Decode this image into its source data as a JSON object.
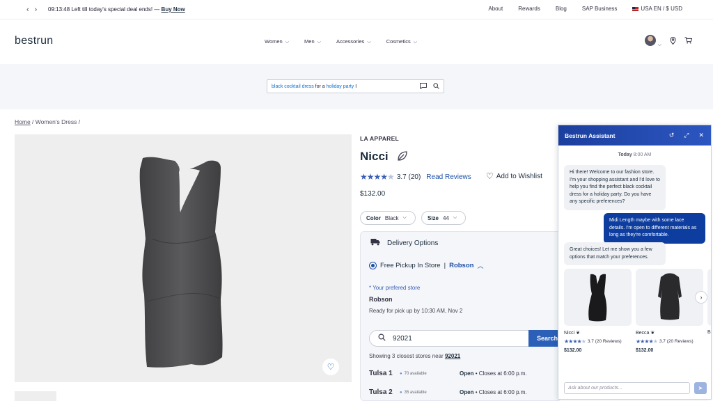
{
  "promo": {
    "timer": "09:13:48",
    "message": "Left till today's special deal ends! —",
    "cta": "Buy Now",
    "links": [
      "About",
      "Rewards",
      "Blog",
      "SAP Business"
    ],
    "locale": "USA EN / $ USD"
  },
  "header": {
    "logo": "bestrun",
    "nav": [
      "Women",
      "Men",
      "Accessories",
      "Cosmetics"
    ]
  },
  "search": {
    "q1": "black",
    "q2": " cocktail dress ",
    "q3": "for a ",
    "q4": "holiday party",
    "q5": " I"
  },
  "breadcrumb": {
    "home": "Home",
    "category": "Women's Dress"
  },
  "product": {
    "brand": "LA APPAREL",
    "name": "Nicci",
    "rating": 3.7,
    "rating_text": "3.7 (20)",
    "reviews_link": "Read Reviews",
    "wishlist": "Add to Wishlist",
    "price": "$132.00",
    "color_label": "Color",
    "color_value": "Black",
    "size_label": "Size",
    "size_value": "44"
  },
  "delivery": {
    "title": "Delivery Options",
    "option": "Free Pickup In Store",
    "selected_store": "Robson",
    "pref_label": "* Your prefered store",
    "pref_store": "Robson",
    "ready": "Ready for pick up by 10:30 AM, Nov 2",
    "zip": "92021",
    "search_btn": "Search",
    "showing_prefix": "Showing 3 closest stores near",
    "showing_zip": "92021",
    "stores": [
      {
        "name": "Tulsa 1",
        "available": "70 available",
        "status": "Open",
        "closes": "• Closes at 6:00 p.m."
      },
      {
        "name": "Tulsa 2",
        "available": "35 available",
        "status": "Open",
        "closes": "• Closes at 6:00 p.m."
      }
    ]
  },
  "assistant": {
    "title": "Bestrun Assistant",
    "today": "Today",
    "time": "8:00 AM",
    "msg1": "Hi there! Welcome to our fashion store. I'm your shopping assistant and I'd love to help you find the perfect black cocktail dress for a holiday party. Do you have any specific preferences?",
    "msg2": "Midi Length maybe with some lace details. I'm open to different materials as long as they're comfortable.",
    "msg3": "Great choices! Let me show you a few options that match your preferences.",
    "cards": [
      {
        "name": "Nicci",
        "rating": 3.7,
        "reviews": "3.7 (20 Reviews)",
        "price": "$132.00"
      },
      {
        "name": "Becca",
        "rating": 3.7,
        "reviews": "3.7 (20 Reviews)",
        "price": "$132.00"
      },
      {
        "name": "Be"
      }
    ],
    "input_placeholder": "Ask about our products..."
  },
  "colors": {
    "accent": "#2b5fb8",
    "header_gradient_start": "#1b3f9e",
    "user_bubble": "#0d3d9e"
  }
}
